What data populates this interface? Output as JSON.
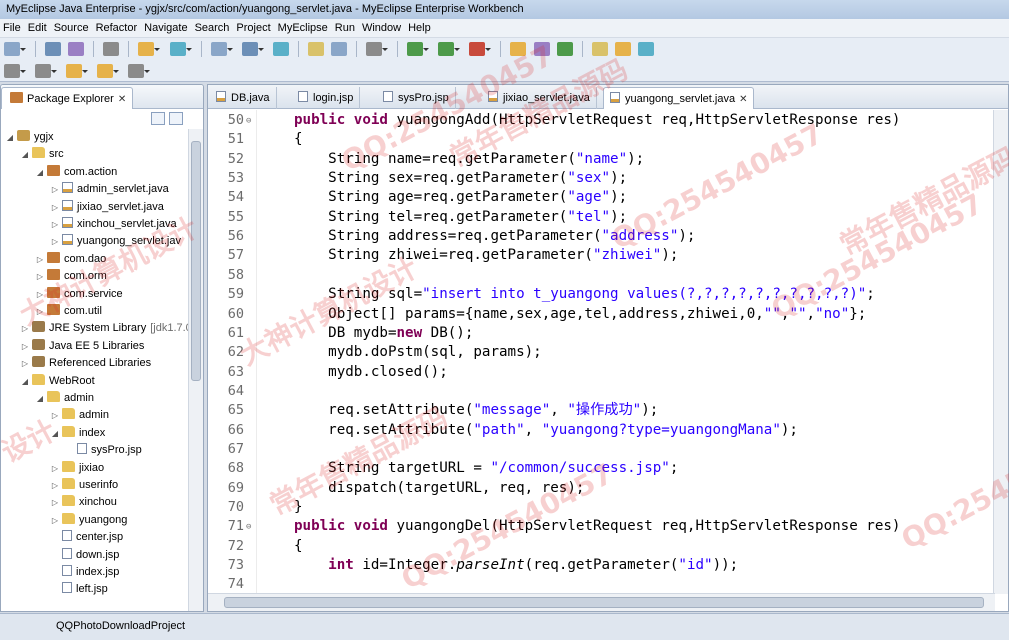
{
  "window": {
    "title": "MyEclipse Java Enterprise - ygjx/src/com/action/yuangong_servlet.java - MyEclipse Enterprise Workbench"
  },
  "menu": [
    "File",
    "Edit",
    "Source",
    "Refactor",
    "Navigate",
    "Search",
    "Project",
    "MyEclipse",
    "Run",
    "Window",
    "Help"
  ],
  "explorer": {
    "tab_label": "Package Explorer",
    "tree": [
      {
        "label": "ygjx",
        "icon": "project-icon",
        "depth": 0,
        "twisty": "open"
      },
      {
        "label": "src",
        "icon": "folder-icon",
        "depth": 1,
        "twisty": "open"
      },
      {
        "label": "com.action",
        "icon": "package-icon",
        "depth": 2,
        "twisty": "open"
      },
      {
        "label": "admin_servlet.java",
        "icon": "java-file-icon",
        "depth": 3,
        "twisty": "closed"
      },
      {
        "label": "jixiao_servlet.java",
        "icon": "java-file-icon",
        "depth": 3,
        "twisty": "closed"
      },
      {
        "label": "xinchou_servlet.java",
        "icon": "java-file-icon",
        "depth": 3,
        "twisty": "closed"
      },
      {
        "label": "yuangong_servlet.jav",
        "icon": "java-file-icon",
        "depth": 3,
        "twisty": "closed"
      },
      {
        "label": "com.dao",
        "icon": "package-icon",
        "depth": 2,
        "twisty": "closed"
      },
      {
        "label": "com.orm",
        "icon": "package-icon",
        "depth": 2,
        "twisty": "closed"
      },
      {
        "label": "com.service",
        "icon": "package-icon",
        "depth": 2,
        "twisty": "closed"
      },
      {
        "label": "com.util",
        "icon": "package-icon",
        "depth": 2,
        "twisty": "closed"
      },
      {
        "label": "JRE System Library",
        "suffix": "[jdk1.7.0",
        "icon": "library-icon",
        "depth": 1,
        "twisty": "closed"
      },
      {
        "label": "Java EE 5 Libraries",
        "icon": "library-icon",
        "depth": 1,
        "twisty": "closed"
      },
      {
        "label": "Referenced Libraries",
        "icon": "library-icon",
        "depth": 1,
        "twisty": "closed"
      },
      {
        "label": "WebRoot",
        "icon": "folder-icon",
        "depth": 1,
        "twisty": "open"
      },
      {
        "label": "admin",
        "icon": "folder-icon",
        "depth": 2,
        "twisty": "open"
      },
      {
        "label": "admin",
        "icon": "folder-icon",
        "depth": 3,
        "twisty": "closed"
      },
      {
        "label": "index",
        "icon": "folder-icon",
        "depth": 3,
        "twisty": "open"
      },
      {
        "label": "sysPro.jsp",
        "icon": "file-icon",
        "depth": 4,
        "twisty": ""
      },
      {
        "label": "jixiao",
        "icon": "folder-icon",
        "depth": 3,
        "twisty": "closed"
      },
      {
        "label": "userinfo",
        "icon": "folder-icon",
        "depth": 3,
        "twisty": "closed"
      },
      {
        "label": "xinchou",
        "icon": "folder-icon",
        "depth": 3,
        "twisty": "closed"
      },
      {
        "label": "yuangong",
        "icon": "folder-icon",
        "depth": 3,
        "twisty": "closed"
      },
      {
        "label": "center.jsp",
        "icon": "file-icon",
        "depth": 3,
        "twisty": ""
      },
      {
        "label": "down.jsp",
        "icon": "file-icon",
        "depth": 3,
        "twisty": ""
      },
      {
        "label": "index.jsp",
        "icon": "file-icon",
        "depth": 3,
        "twisty": ""
      },
      {
        "label": "left.jsp",
        "icon": "file-icon",
        "depth": 3,
        "twisty": ""
      }
    ]
  },
  "editor": {
    "tabs": [
      {
        "label": "DB.java",
        "active": false
      },
      {
        "label": "login.jsp",
        "active": false
      },
      {
        "label": "sysPro.jsp",
        "active": false
      },
      {
        "label": "jixiao_servlet.java",
        "active": false
      },
      {
        "label": "yuangong_servlet.java",
        "active": true
      }
    ],
    "lines": [
      {
        "n": "50",
        "fold": "⊖",
        "t": [
          [
            "kw",
            "public void "
          ],
          [
            "p",
            "yuangongAdd(HttpServletRequest req,HttpServletResponse res)"
          ]
        ]
      },
      {
        "n": "51",
        "t": [
          [
            "p",
            "{"
          ]
        ]
      },
      {
        "n": "52",
        "t": [
          [
            "p",
            "    String name=req.getParameter("
          ],
          [
            "s",
            "\"name\""
          ],
          [
            "p",
            ");"
          ]
        ]
      },
      {
        "n": "53",
        "t": [
          [
            "p",
            "    String sex=req.getParameter("
          ],
          [
            "s",
            "\"sex\""
          ],
          [
            "p",
            ");"
          ]
        ]
      },
      {
        "n": "54",
        "t": [
          [
            "p",
            "    String age=req.getParameter("
          ],
          [
            "s",
            "\"age\""
          ],
          [
            "p",
            ");"
          ]
        ]
      },
      {
        "n": "55",
        "t": [
          [
            "p",
            "    String tel=req.getParameter("
          ],
          [
            "s",
            "\"tel\""
          ],
          [
            "p",
            ");"
          ]
        ]
      },
      {
        "n": "56",
        "t": [
          [
            "p",
            "    String address=req.getParameter("
          ],
          [
            "s",
            "\"address\""
          ],
          [
            "p",
            ");"
          ]
        ]
      },
      {
        "n": "57",
        "t": [
          [
            "p",
            "    String zhiwei=req.getParameter("
          ],
          [
            "s",
            "\"zhiwei\""
          ],
          [
            "p",
            ");"
          ]
        ]
      },
      {
        "n": "58",
        "t": []
      },
      {
        "n": "59",
        "t": [
          [
            "p",
            "    String sql="
          ],
          [
            "s",
            "\"insert into t_yuangong values(?,?,?,?,?,?,?,?,?,?)\""
          ],
          [
            "p",
            ";"
          ]
        ]
      },
      {
        "n": "60",
        "t": [
          [
            "p",
            "    Object[] params={name,sex,age,tel,address,zhiwei,0,"
          ],
          [
            "s",
            "\"\""
          ],
          [
            "p",
            ","
          ],
          [
            "s",
            "\"\""
          ],
          [
            "p",
            ","
          ],
          [
            "s",
            "\"no\""
          ],
          [
            "p",
            "};"
          ]
        ]
      },
      {
        "n": "61",
        "t": [
          [
            "p",
            "    DB mydb="
          ],
          [
            "kw",
            "new "
          ],
          [
            "p",
            "DB();"
          ]
        ]
      },
      {
        "n": "62",
        "t": [
          [
            "p",
            "    mydb.doPstm(sql, params);"
          ]
        ]
      },
      {
        "n": "63",
        "t": [
          [
            "p",
            "    mydb.closed();"
          ]
        ]
      },
      {
        "n": "64",
        "t": []
      },
      {
        "n": "65",
        "t": [
          [
            "p",
            "    req.setAttribute("
          ],
          [
            "s",
            "\"message\""
          ],
          [
            "p",
            ", "
          ],
          [
            "s",
            "\"操作成功\""
          ],
          [
            "p",
            ");"
          ]
        ]
      },
      {
        "n": "66",
        "t": [
          [
            "p",
            "    req.setAttribute("
          ],
          [
            "s",
            "\"path\""
          ],
          [
            "p",
            ", "
          ],
          [
            "s",
            "\"yuangong?type=yuangongMana\""
          ],
          [
            "p",
            ");"
          ]
        ]
      },
      {
        "n": "67",
        "t": []
      },
      {
        "n": "68",
        "t": [
          [
            "p",
            "    String targetURL = "
          ],
          [
            "s",
            "\"/common/success.jsp\""
          ],
          [
            "p",
            ";"
          ]
        ]
      },
      {
        "n": "69",
        "t": [
          [
            "p",
            "    dispatch(targetURL, req, res);"
          ]
        ]
      },
      {
        "n": "70",
        "t": [
          [
            "p",
            "}"
          ]
        ]
      },
      {
        "n": "71",
        "fold": "⊖",
        "t": [
          [
            "kw",
            "public void "
          ],
          [
            "p",
            "yuangongDel(HttpServletRequest req,HttpServletResponse res)"
          ]
        ]
      },
      {
        "n": "72",
        "t": [
          [
            "p",
            "{"
          ]
        ]
      },
      {
        "n": "73",
        "t": [
          [
            "p",
            "    "
          ],
          [
            "kw",
            "int "
          ],
          [
            "p",
            "id=Integer."
          ],
          [
            "i",
            "parseInt"
          ],
          [
            "p",
            "(req.getParameter("
          ],
          [
            "s",
            "\"id\""
          ],
          [
            "p",
            "));"
          ]
        ]
      },
      {
        "n": "74",
        "t": []
      }
    ]
  },
  "status": {
    "text": "QQPhotoDownloadProject"
  },
  "watermarks": [
    "QQ:254540457",
    "常年售精品源码",
    "大神计算机设计",
    "QQ:254540457",
    "常年售精品源码",
    "QQ:254540457",
    "大神计算机设计",
    "常年售精品源码",
    "QQ:254540457",
    "QQ:254540457",
    "设计"
  ]
}
